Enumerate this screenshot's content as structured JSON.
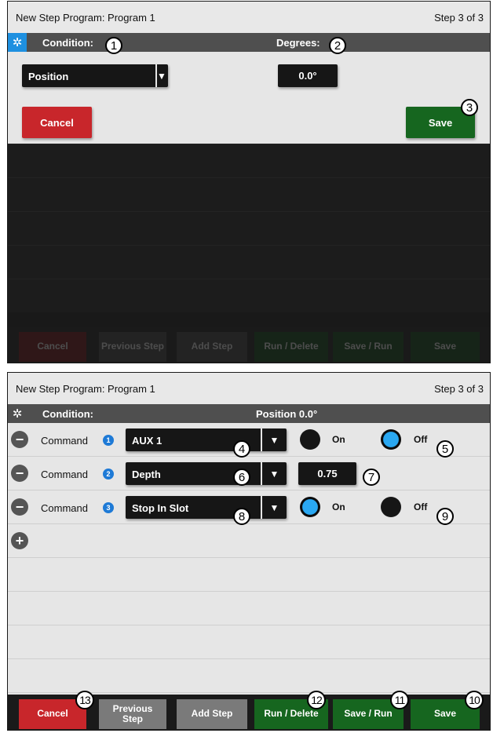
{
  "panel1": {
    "title": "New Step Program:  Program 1",
    "step": "Step 3 of 3",
    "condition_label": "Condition:",
    "degrees_label": "Degrees:",
    "condition_value": "Position",
    "degrees_value": "0.0°",
    "cancel_label": "Cancel",
    "save_label": "Save",
    "footer": [
      "Cancel",
      "Previous Step",
      "Add Step",
      "Run / Delete",
      "Save / Run",
      "Save"
    ]
  },
  "panel2": {
    "title": "New Step Program:  Program 1",
    "step": "Step 3 of 3",
    "condition_label": "Condition:",
    "condition_value": "Position 0.0°",
    "commands": [
      {
        "label": "Command",
        "num": "1",
        "selection": "AUX 1",
        "on_label": "On",
        "off_label": "Off",
        "on_selected": false,
        "off_selected": true
      },
      {
        "label": "Command",
        "num": "2",
        "selection": "Depth",
        "value": "0.75"
      },
      {
        "label": "Command",
        "num": "3",
        "selection": "Stop In Slot",
        "on_label": "On",
        "off_label": "Off",
        "on_selected": true,
        "off_selected": false
      }
    ],
    "add_icon": "plus-icon",
    "footer": {
      "cancel": "Cancel",
      "previous_line1": "Previous",
      "previous_line2": "Step",
      "add_step": "Add Step",
      "run_delete": "Run / Delete",
      "save_run": "Save / Run",
      "save": "Save"
    }
  },
  "callouts": [
    "1",
    "2",
    "3",
    "4",
    "5",
    "6",
    "7",
    "8",
    "9",
    "10",
    "11",
    "12",
    "13"
  ],
  "colors": {
    "accent_blue": "#1e90e0",
    "cancel_red": "#c8262b",
    "save_green": "#16661f",
    "header_gray": "#4f4f4f"
  }
}
